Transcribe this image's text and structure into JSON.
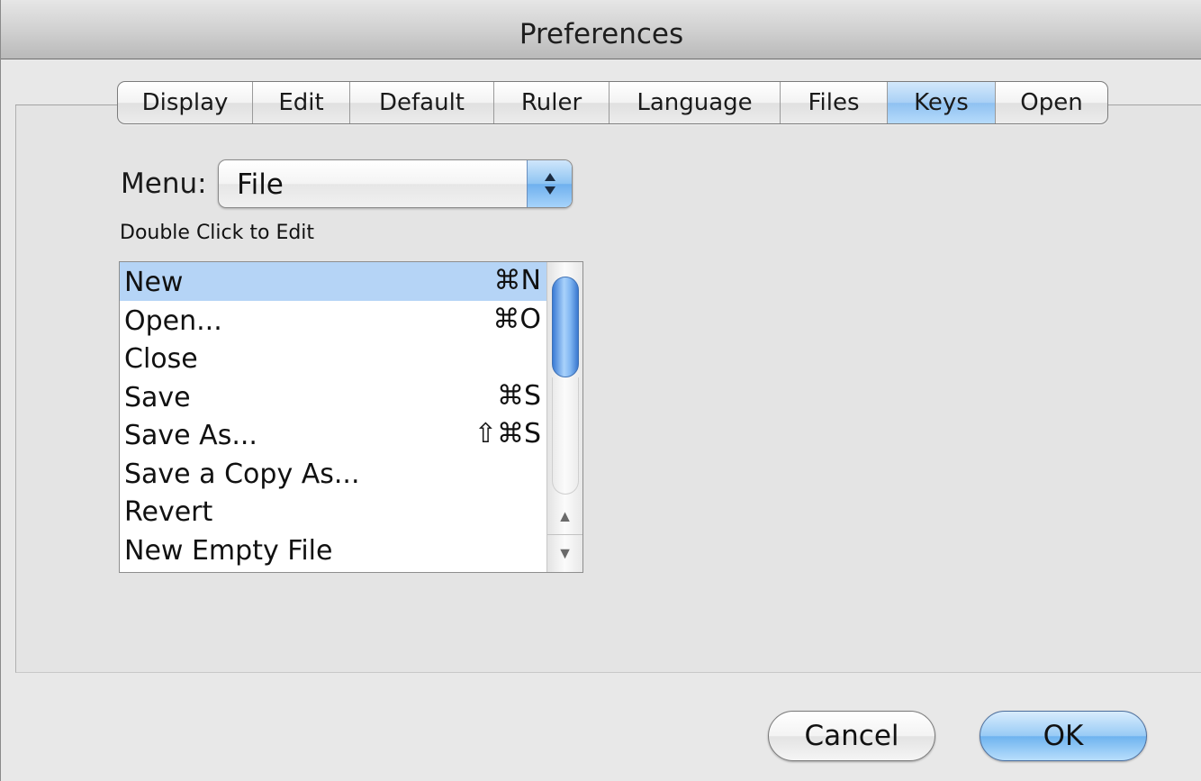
{
  "window": {
    "title": "Preferences"
  },
  "tabs": [
    {
      "label": "Display"
    },
    {
      "label": "Edit"
    },
    {
      "label": "Default"
    },
    {
      "label": "Ruler"
    },
    {
      "label": "Language"
    },
    {
      "label": "Files"
    },
    {
      "label": "Keys",
      "active": true
    },
    {
      "label": "Open"
    }
  ],
  "menu": {
    "label": "Menu:",
    "selected": "File"
  },
  "hint": "Double Click to Edit",
  "commands": [
    {
      "name": "New",
      "shortcut": "⌘N",
      "selected": true
    },
    {
      "name": "Open...",
      "shortcut": "⌘O"
    },
    {
      "name": "Close",
      "shortcut": ""
    },
    {
      "name": "Save",
      "shortcut": "⌘S"
    },
    {
      "name": "Save As...",
      "shortcut": "⇧⌘S"
    },
    {
      "name": "Save a Copy As...",
      "shortcut": ""
    },
    {
      "name": "Revert",
      "shortcut": ""
    },
    {
      "name": "New Empty File",
      "shortcut": ""
    }
  ],
  "buttons": {
    "cancel": "Cancel",
    "ok": "OK"
  },
  "colors": {
    "selection": "#b5d4f6",
    "accent": "#6eb3ef"
  },
  "icons": {
    "scroll_up": "up-arrow-icon",
    "scroll_down": "down-arrow-icon",
    "popup": "up-down-arrows-icon"
  }
}
